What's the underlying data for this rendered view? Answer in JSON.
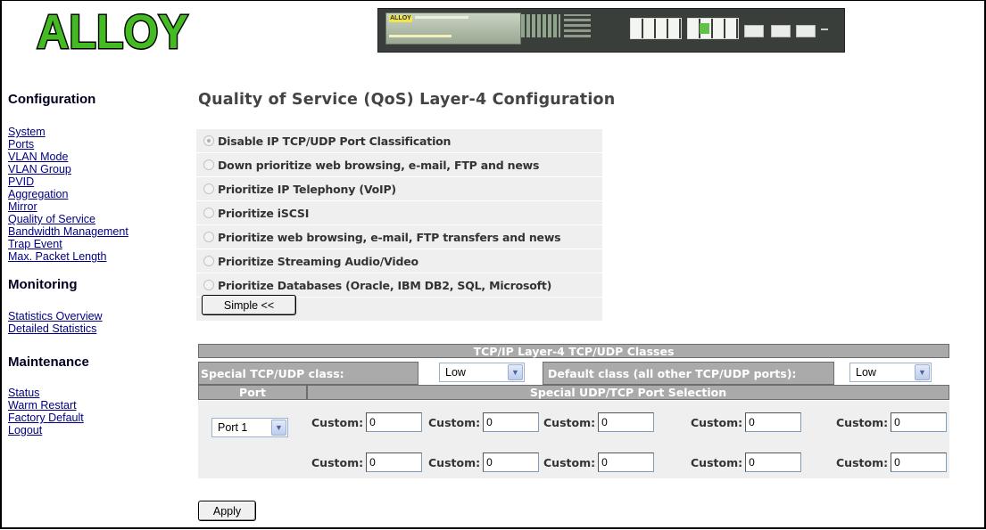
{
  "header": {
    "logo_text": "ALLOY",
    "device_brand": "ALLOY",
    "accent": "#44bb22"
  },
  "sidebar": {
    "config_heading": "Configuration",
    "config_items": [
      "System",
      "Ports",
      "VLAN Mode",
      "VLAN Group",
      "PVID",
      "Aggregation",
      "Mirror",
      "Quality of Service",
      "Bandwidth Management",
      "Trap Event",
      "Max. Packet Length"
    ],
    "monitoring_heading": "Monitoring",
    "monitoring_items": [
      "Statistics Overview",
      "Detailed Statistics"
    ],
    "maintenance_heading": "Maintenance",
    "maintenance_items": [
      "Status",
      "Warm Restart",
      "Factory Default",
      "Logout"
    ]
  },
  "main": {
    "title": "Quality of Service (QoS) Layer-4 Configuration",
    "options": [
      {
        "label": "Disable IP TCP/UDP Port Classification",
        "checked": true
      },
      {
        "label": "Down prioritize web browsing, e-mail, FTP and news",
        "checked": false
      },
      {
        "label": "Prioritize IP Telephony (VoIP)",
        "checked": false
      },
      {
        "label": "Prioritize iSCSI",
        "checked": false
      },
      {
        "label": "Prioritize web browsing, e-mail, FTP transfers and news",
        "checked": false
      },
      {
        "label": "Prioritize Streaming Audio/Video",
        "checked": false
      },
      {
        "label": "Prioritize Databases (Oracle, IBM DB2, SQL, Microsoft)",
        "checked": false
      }
    ],
    "simple_button": "Simple <<",
    "classes_table": {
      "title": "TCP/IP Layer-4 TCP/UDP Classes",
      "special_label": "Special TCP/UDP class:",
      "special_value": "Low",
      "default_label": "Default class (all other TCP/UDP ports):",
      "default_value": "Low",
      "port_header": "Port",
      "selection_header": "Special UDP/TCP Port Selection",
      "port_value": "Port 1",
      "custom_label": "Custom:",
      "custom_values": [
        "0",
        "0",
        "0",
        "0",
        "0",
        "0",
        "0",
        "0",
        "0",
        "0"
      ]
    },
    "apply_button": "Apply"
  }
}
